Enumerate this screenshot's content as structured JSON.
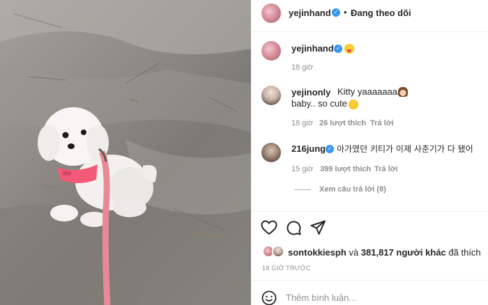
{
  "header": {
    "username": "yejinhand",
    "separator": "•",
    "follow_status": "Đang theo dõi"
  },
  "caption": {
    "username": "yejinhand",
    "time": "18 giờ"
  },
  "comments": [
    {
      "username": "yejinonly",
      "text_line1": "Kitty yaaaaaaaa~",
      "text_line2": "baby.. so cute",
      "time": "18 giờ",
      "likes": "26 lượt thích",
      "reply": "Trả lời"
    },
    {
      "username": "216jung",
      "text": "아가였던 키티가 이제 사춘기가 다 됐어",
      "time": "15 giờ",
      "likes": "399 lượt thích",
      "reply": "Trả lời",
      "view_replies": "Xem câu trả lời (8)"
    }
  ],
  "likes_summary": {
    "first_user": "sontokkiesph",
    "middle": "và",
    "others": "381,817 người khác",
    "end": "đã thích"
  },
  "post_time": "18 GIỜ TRƯỚC",
  "comment_input": {
    "placeholder": "Thêm bình luận..."
  },
  "icons": [
    "heart-icon",
    "comment-icon",
    "share-icon",
    "emoji-icon",
    "verified-icon"
  ],
  "colors": {
    "verified": "#3897f0",
    "harness": "#f25a78",
    "leash": "#e88a96"
  }
}
